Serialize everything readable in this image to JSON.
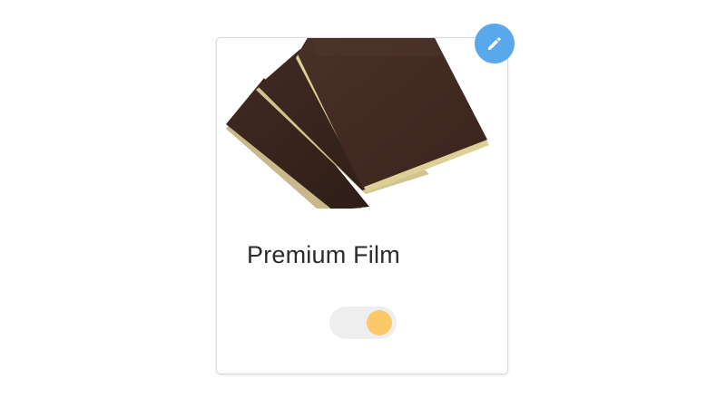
{
  "card": {
    "title": "Premium Film",
    "image_icon": "stacked-brown-film-sheets-image",
    "toggle": {
      "state": "on",
      "track_color": "#eeeeee",
      "knob_color": "#fcc96a"
    }
  },
  "edit_button": {
    "icon": "pencil-icon",
    "color": "#5aa8ec"
  }
}
